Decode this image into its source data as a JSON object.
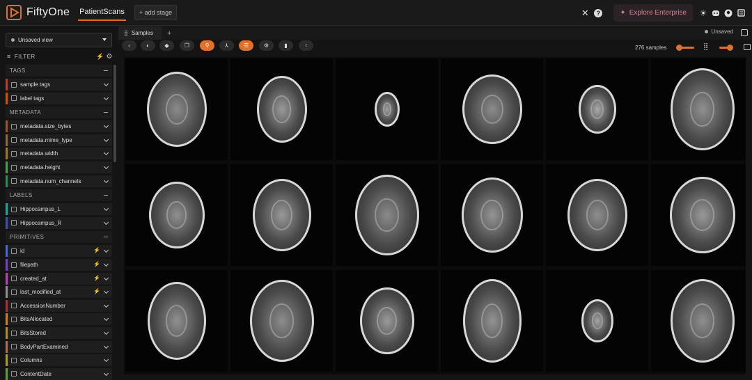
{
  "app": {
    "title": "FiftyOne",
    "dataset": "PatientScans",
    "add_stage": "+ add stage"
  },
  "topbar": {
    "explore_label": "Explore Enterprise",
    "colors": {
      "accent": "#e0712c",
      "explore": "#d9808f"
    }
  },
  "sidebar": {
    "view_label": "Unsaved view",
    "filter_label": "FILTER",
    "sections": [
      {
        "label": "TAGS",
        "fields": [
          "sample tags",
          "label tags"
        ]
      },
      {
        "label": "METADATA",
        "fields": [
          "metadata.size_bytes",
          "metadata.mime_type",
          "metadata.width",
          "metadata.height",
          "metadata.num_channels"
        ]
      },
      {
        "label": "LABELS",
        "fields": [
          "Hippocampus_L",
          "Hippocampus_R"
        ]
      },
      {
        "label": "PRIMITIVES",
        "fields": [
          "id",
          "filepath",
          "created_at",
          "last_modified_at",
          "AccessionNumber",
          "BitsAllocated",
          "BitsStored",
          "BodyPartExamined",
          "Columns",
          "ContentDate"
        ]
      }
    ],
    "field_colors": [
      "#c0392b",
      "#d35400",
      "#a0522d",
      "#8b6b3d",
      "#a07b20",
      "#4aa14a",
      "#2e8b57",
      "#1aaa9a",
      "#3a50c0",
      "#4169e1",
      "#7b3fd0",
      "#c040c0",
      "#909090",
      "#b03030",
      "#d08020",
      "#b09020",
      "#b07050",
      "#a8a020",
      "#60a040"
    ]
  },
  "tabs": {
    "samples_label": "Samples",
    "unsaved_label": "Unsaved"
  },
  "toolbar": {
    "samples_count": "276 samples"
  }
}
